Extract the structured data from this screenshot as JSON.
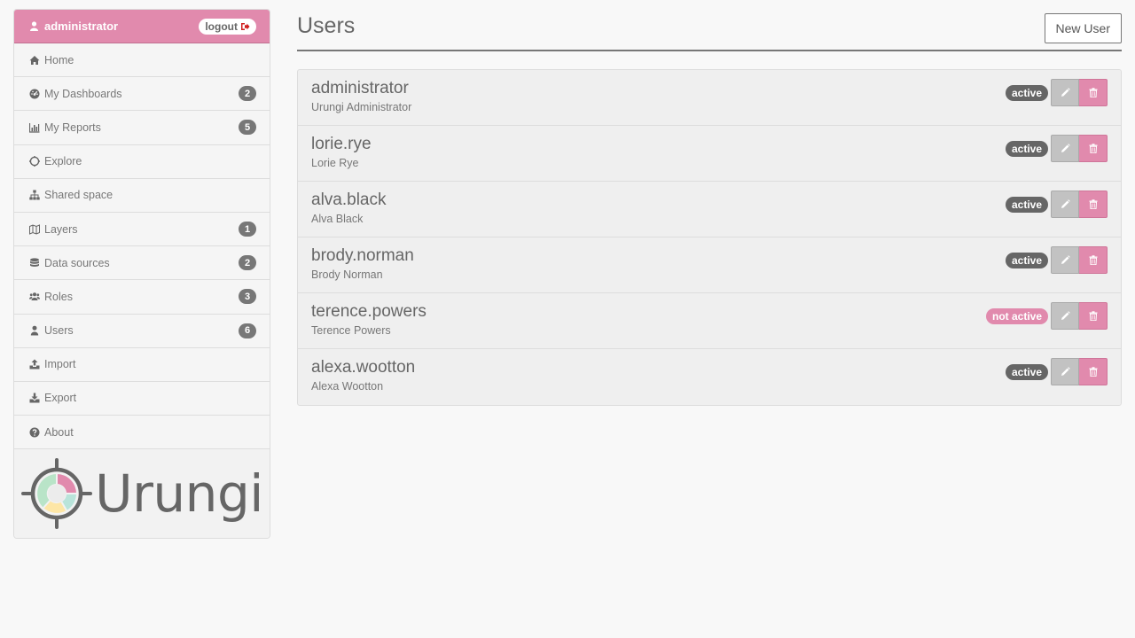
{
  "sidebar": {
    "user": "administrator",
    "logout_label": "logout",
    "items": [
      {
        "label": "Home",
        "icon": "home-icon",
        "count": null
      },
      {
        "label": "My Dashboards",
        "icon": "dashboard-icon",
        "count": "2"
      },
      {
        "label": "My Reports",
        "icon": "bar-chart-icon",
        "count": "5"
      },
      {
        "label": "Explore",
        "icon": "compass-icon",
        "count": null
      },
      {
        "label": "Shared space",
        "icon": "sitemap-icon",
        "count": null
      },
      {
        "label": "Layers",
        "icon": "map-icon",
        "count": "1"
      },
      {
        "label": "Data sources",
        "icon": "database-icon",
        "count": "2"
      },
      {
        "label": "Roles",
        "icon": "users-icon",
        "count": "3"
      },
      {
        "label": "Users",
        "icon": "user-icon",
        "count": "6"
      },
      {
        "label": "Import",
        "icon": "upload-icon",
        "count": null
      },
      {
        "label": "Export",
        "icon": "download-icon",
        "count": null
      },
      {
        "label": "About",
        "icon": "question-icon",
        "count": null
      }
    ],
    "logo_text": "Urungi"
  },
  "main": {
    "title": "Users",
    "new_user_label": "New User",
    "users": [
      {
        "login": "administrator",
        "name": "Urungi Administrator",
        "status": "active"
      },
      {
        "login": "lorie.rye",
        "name": "Lorie Rye",
        "status": "active"
      },
      {
        "login": "alva.black",
        "name": "Alva Black",
        "status": "active"
      },
      {
        "login": "brody.norman",
        "name": "Brody Norman",
        "status": "active"
      },
      {
        "login": "terence.powers",
        "name": "Terence Powers",
        "status": "not active"
      },
      {
        "login": "alexa.wootton",
        "name": "Alexa Wootton",
        "status": "active"
      }
    ]
  },
  "colors": {
    "accent": "#e18aad",
    "badge_dark": "#666666",
    "edit_button": "#c2c2c2"
  }
}
